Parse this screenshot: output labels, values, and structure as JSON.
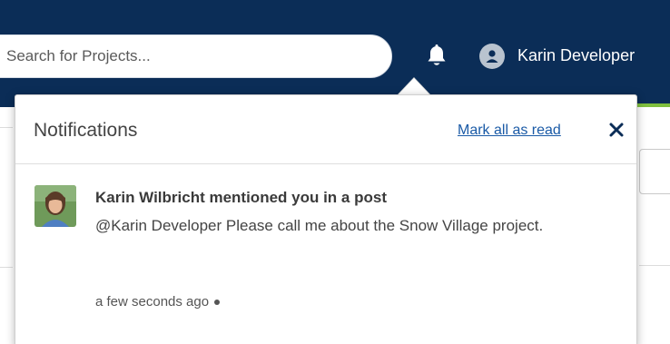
{
  "header": {
    "search": {
      "placeholder": "Search for Projects..."
    },
    "user": {
      "name": "Karin Developer"
    },
    "colors": {
      "navbar": "#0b2d57",
      "accent": "#7fbf3f"
    }
  },
  "notifications": {
    "title": "Notifications",
    "mark_all_label": "Mark all as read",
    "close_icon": "close-icon",
    "items": [
      {
        "title": "Karin Wilbricht mentioned you in a post",
        "message": "@Karin Developer  Please call me about the Snow Village project.",
        "time": "a few seconds ago",
        "avatar_icon": "user-photo"
      }
    ]
  }
}
